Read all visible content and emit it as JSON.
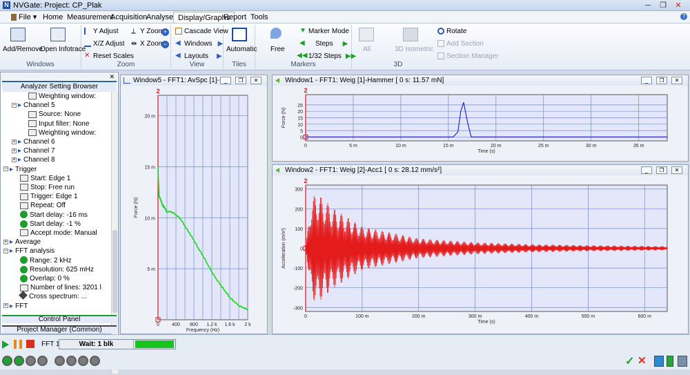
{
  "app": {
    "title": "NVGate: Project: CP_Plak"
  },
  "menu": {
    "file": "File",
    "tabs": [
      "Home",
      "Measurement",
      "Acquisition",
      "Analyses",
      "Display/Graphs",
      "Report",
      "Tools"
    ],
    "active": "Display/Graphs"
  },
  "ribbon": {
    "windows": {
      "name": "Windows",
      "add_remove": "Add/Remove",
      "open_infotrace": "Open Infotrace"
    },
    "zoom": {
      "name": "Zoom",
      "y_adjust": "Y Adjust",
      "xz_adjust": "X/Z Adjust",
      "reset_scales": "Reset Scales",
      "y_zoom": "Y Zoom",
      "x_zoom": "X Zoom"
    },
    "view": {
      "name": "View",
      "cascade": "Cascade View",
      "windows": "Windows",
      "layouts": "Layouts"
    },
    "tiles": {
      "name": "Tiles",
      "automatic": "Automatic"
    },
    "markers": {
      "name": "Markers",
      "free": "Free",
      "marker_mode": "Marker Mode",
      "steps": "Steps",
      "steps_132": "1/32 Steps"
    },
    "d3": {
      "name": "3D",
      "all": "All",
      "iso": "3D Isometric",
      "rotate": "Rotate",
      "add_section": "Add Section",
      "section_manager": "Section Manager"
    }
  },
  "left_panel": {
    "title": "Analyzer Setting Browser",
    "tree": [
      {
        "label": "Weighting window:",
        "kind": "leaf",
        "indent": 3
      },
      {
        "label": "Channel 5",
        "kind": "chan-open",
        "indent": 1
      },
      {
        "label": "Source: None",
        "kind": "leaf",
        "indent": 3
      },
      {
        "label": "Input filter: None",
        "kind": "leaf",
        "indent": 3
      },
      {
        "label": "Weighting window:",
        "kind": "leaf",
        "indent": 3
      },
      {
        "label": "Channel 6",
        "kind": "chan",
        "indent": 1
      },
      {
        "label": "Channel 7",
        "kind": "chan",
        "indent": 1
      },
      {
        "label": "Channel 8",
        "kind": "chan",
        "indent": 1
      },
      {
        "label": "Trigger",
        "kind": "group-open",
        "indent": 0
      },
      {
        "label": "Start: Edge 1",
        "kind": "leaf",
        "indent": 2
      },
      {
        "label": "Stop: Free run",
        "kind": "leaf",
        "indent": 2
      },
      {
        "label": "Trigger: Edge 1",
        "kind": "leaf",
        "indent": 2
      },
      {
        "label": "Repeat: Off",
        "kind": "leaf",
        "indent": 2
      },
      {
        "label": "Start delay: -16 ms",
        "kind": "green",
        "indent": 2
      },
      {
        "label": "Start delay: -1 %",
        "kind": "green",
        "indent": 2
      },
      {
        "label": "Accept mode: Manual",
        "kind": "leaf",
        "indent": 2
      },
      {
        "label": "Average",
        "kind": "group",
        "indent": 0
      },
      {
        "label": "FFT analysis",
        "kind": "group-open",
        "indent": 0
      },
      {
        "label": "Range: 2 kHz",
        "kind": "green",
        "indent": 2
      },
      {
        "label": "Resolution: 625 mHz",
        "kind": "green",
        "indent": 2
      },
      {
        "label": "Overlap: 0 %",
        "kind": "green",
        "indent": 2
      },
      {
        "label": "Number of lines: 3201 l",
        "kind": "leaf",
        "indent": 2
      },
      {
        "label": "Cross spectrum: ...",
        "kind": "diamond",
        "indent": 2
      },
      {
        "label": "FFT",
        "kind": "group",
        "indent": 0
      }
    ],
    "control_panel": "Control Panel",
    "project_manager": "Project Manager (Common)"
  },
  "status": {
    "fft": "FFT 1",
    "wait": "Wait: 1 blk",
    "progress": 1.0
  },
  "windows": [
    {
      "id": "w5",
      "title": "Window5 - FFT1: AvSpc [1]-..."
    },
    {
      "id": "w1",
      "title": "Window1 - FFT1: Weig [1]-Hammer [ 0 s: 11.57 mN]"
    },
    {
      "id": "w2",
      "title": "Window2 - FFT1: Weig [2]-Acc1 [ 0 s: 28.12 mm/s²]"
    }
  ],
  "colors": {
    "plot_bg": "#e4e7fa",
    "grid": "#6c8ec9",
    "spectrum": "#16d91b",
    "hammer": "#2229c4",
    "acc": "#e31b1b",
    "marker": "#d8141a"
  },
  "chart_data": [
    {
      "type": "line",
      "title": "",
      "xlabel": "Frequency (Hz)",
      "ylabel": "Force (N)",
      "xlim": [
        0,
        2000
      ],
      "ylim": [
        0,
        22
      ],
      "x_ticks": [
        "0",
        "400",
        "800",
        "1.2 k",
        "1.6 k",
        "2 k"
      ],
      "y_ticks": [
        "5 m",
        "10 m",
        "15 m",
        "20 m"
      ],
      "marker_label": "2",
      "series": [
        {
          "x": [
            0,
            20,
            100,
            200,
            300,
            400,
            500,
            600,
            700,
            800,
            900,
            1000,
            1100,
            1200,
            1300,
            1400,
            1500,
            1600,
            1700,
            1800,
            1900,
            2000
          ],
          "values": [
            15,
            12.2,
            11.3,
            10.6,
            10.6,
            10.3,
            9.9,
            9.2,
            8.5,
            7.8,
            7.0,
            6.3,
            5.5,
            4.7,
            4.0,
            3.4,
            2.8,
            2.2,
            1.8,
            1.4,
            1.2,
            1.0
          ]
        }
      ]
    },
    {
      "type": "line",
      "title": "",
      "xlabel": "Time (s)",
      "ylabel": "Force (N)",
      "xlim": [
        0,
        0.038
      ],
      "ylim": [
        -3,
        33
      ],
      "x_ticks": [
        "0",
        "5 m",
        "10 m",
        "15 m",
        "20 m",
        "25 m",
        "30 m",
        "35 m"
      ],
      "y_ticks": [
        "0",
        "5",
        "10",
        "15",
        "20",
        "25"
      ],
      "marker_label": "2",
      "series": [
        {
          "x": [
            0,
            0.0155,
            0.016,
            0.0163,
            0.0166,
            0.017,
            0.0174,
            0.038
          ],
          "values": [
            0,
            0,
            4,
            20,
            27,
            12,
            0,
            0
          ]
        }
      ]
    },
    {
      "type": "line",
      "title": "",
      "xlabel": "Time (s)",
      "ylabel": "Acceleration (m/s²)",
      "xlim": [
        0,
        0.64
      ],
      "ylim": [
        -320,
        320
      ],
      "x_ticks": [
        "0",
        "100 m",
        "200 m",
        "300 m",
        "400 m",
        "500 m",
        "600 m"
      ],
      "y_ticks": [
        "-300",
        "-200",
        "-100",
        "0",
        "100",
        "200",
        "300"
      ],
      "marker_label": "2",
      "series": [
        {
          "name": "",
          "x": [
            0,
            0.01,
            0.02,
            0.05,
            0.1,
            0.2,
            0.3,
            0.4,
            0.5,
            0.64
          ],
          "values": [
            0,
            250,
            280,
            200,
            110,
            50,
            30,
            20,
            15,
            10
          ]
        }
      ]
    }
  ]
}
